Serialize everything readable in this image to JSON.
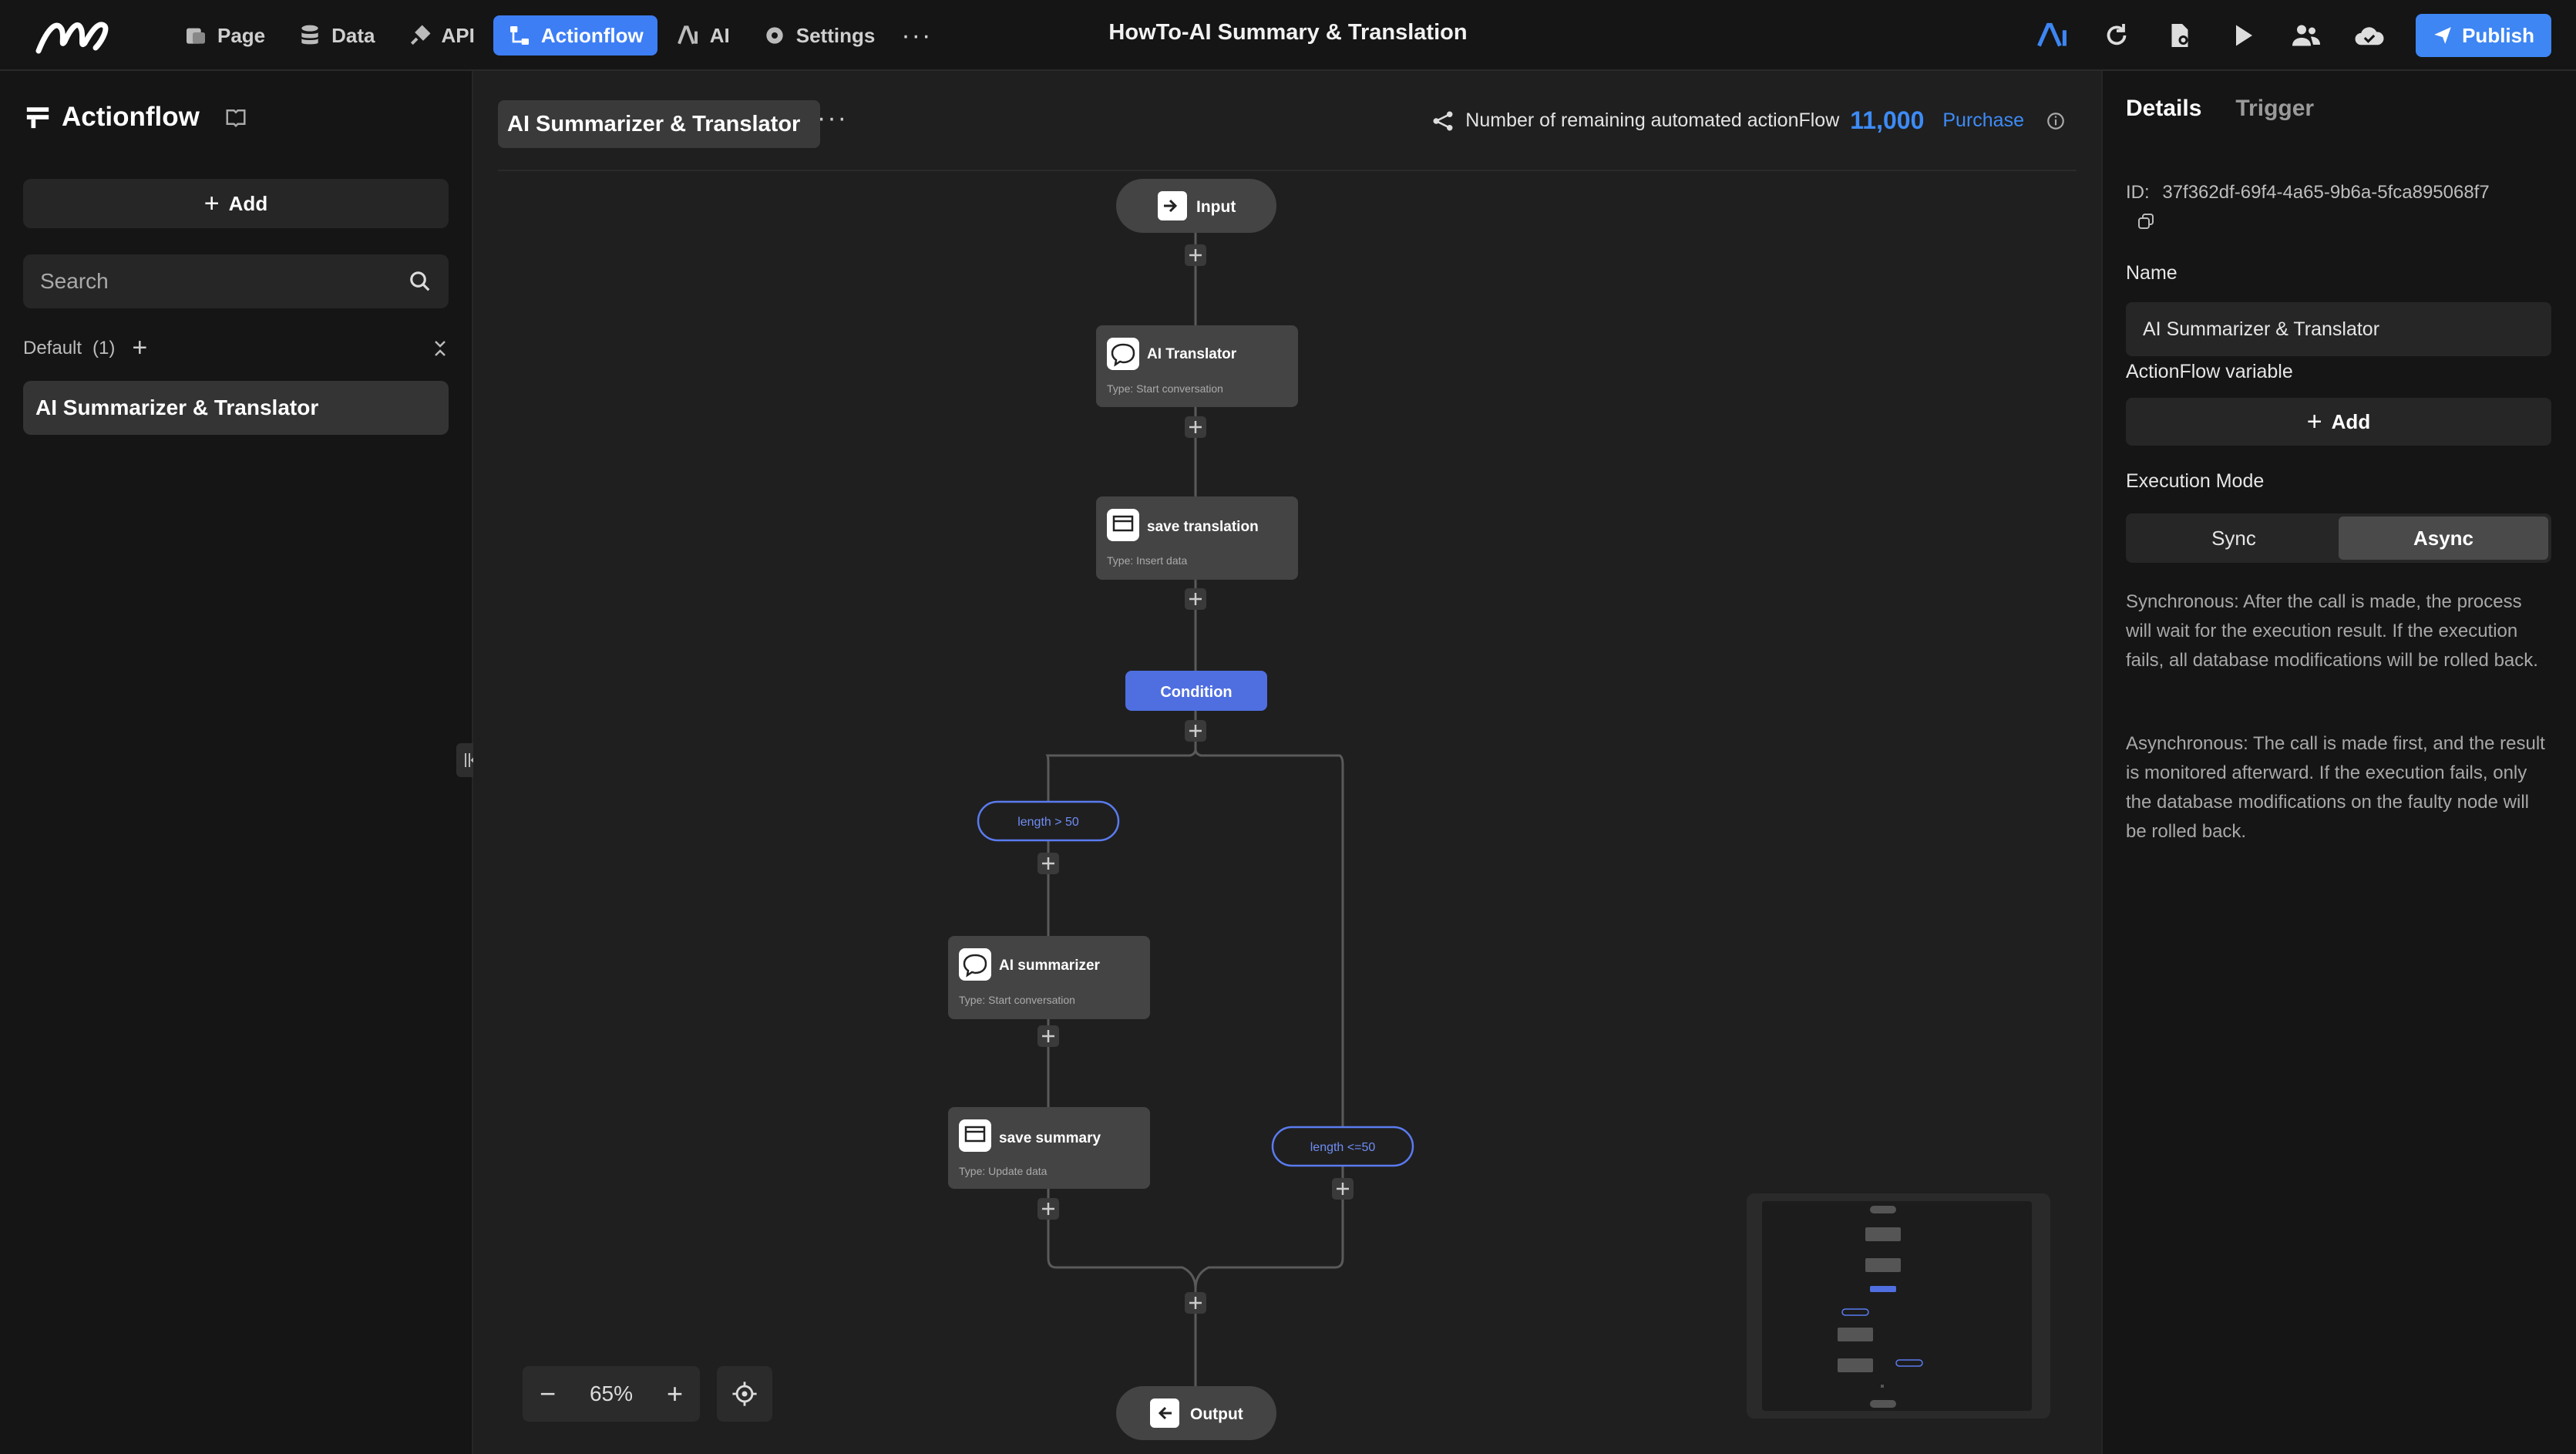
{
  "app": {
    "title": "HowTo-AI Summary & Translation"
  },
  "nav": {
    "items": [
      {
        "label": "Page",
        "icon": "page-icon"
      },
      {
        "label": "Data",
        "icon": "database-icon"
      },
      {
        "label": "API",
        "icon": "plug-icon"
      },
      {
        "label": "Actionflow",
        "icon": "flow-icon"
      },
      {
        "label": "AI",
        "icon": "ai-icon"
      },
      {
        "label": "Settings",
        "icon": "gear-icon"
      }
    ],
    "more": "···",
    "publish": "Publish"
  },
  "sidebar": {
    "title": "Actionflow",
    "add_label": "Add",
    "search_placeholder": "Search",
    "group_name": "Default",
    "group_count": "(1)",
    "items": [
      {
        "label": "AI Summarizer & Translator"
      }
    ]
  },
  "canvas": {
    "flow_title": "AI Summarizer & Translator",
    "remaining_label": "Number of remaining automated actionFlow",
    "remaining_count": "11,000",
    "purchase": "Purchase",
    "zoom": "65%",
    "nodes": {
      "input": "Input",
      "output": "Output",
      "condition": "Condition",
      "translator": {
        "title": "AI Translator",
        "type": "Type:  Start conversation"
      },
      "save_translation": {
        "title": "save translation",
        "type": "Type:  Insert data"
      },
      "summarizer": {
        "title": "AI summarizer",
        "type": "Type:  Start conversation"
      },
      "save_summary": {
        "title": "save summary",
        "type": "Type:  Update data"
      },
      "branch_a": "length > 50",
      "branch_b": "length <=50"
    }
  },
  "details": {
    "tabs": [
      "Details",
      "Trigger"
    ],
    "id_label": "ID:",
    "id_value": "37f362df-69f4-4a65-9b6a-5fca895068f7",
    "name_label": "Name",
    "name_value": "AI Summarizer & Translator",
    "variable_label": "ActionFlow variable",
    "add_label": "Add",
    "mode_label": "Execution Mode",
    "mode_options": [
      "Sync",
      "Async"
    ],
    "mode_selected": "Async",
    "sync_desc": "Synchronous: After the call is made, the process will wait for the execution result. If the execution fails, all database modifications will be rolled back.",
    "async_desc": "Asynchronous: The call is made first, and the result is monitored afterward. If the execution fails, only the database modifications on the faulty node will be rolled back."
  },
  "colors": {
    "accent": "#3d7ef5",
    "condition": "#4f6fe0",
    "branch": "#5a7bf0"
  }
}
